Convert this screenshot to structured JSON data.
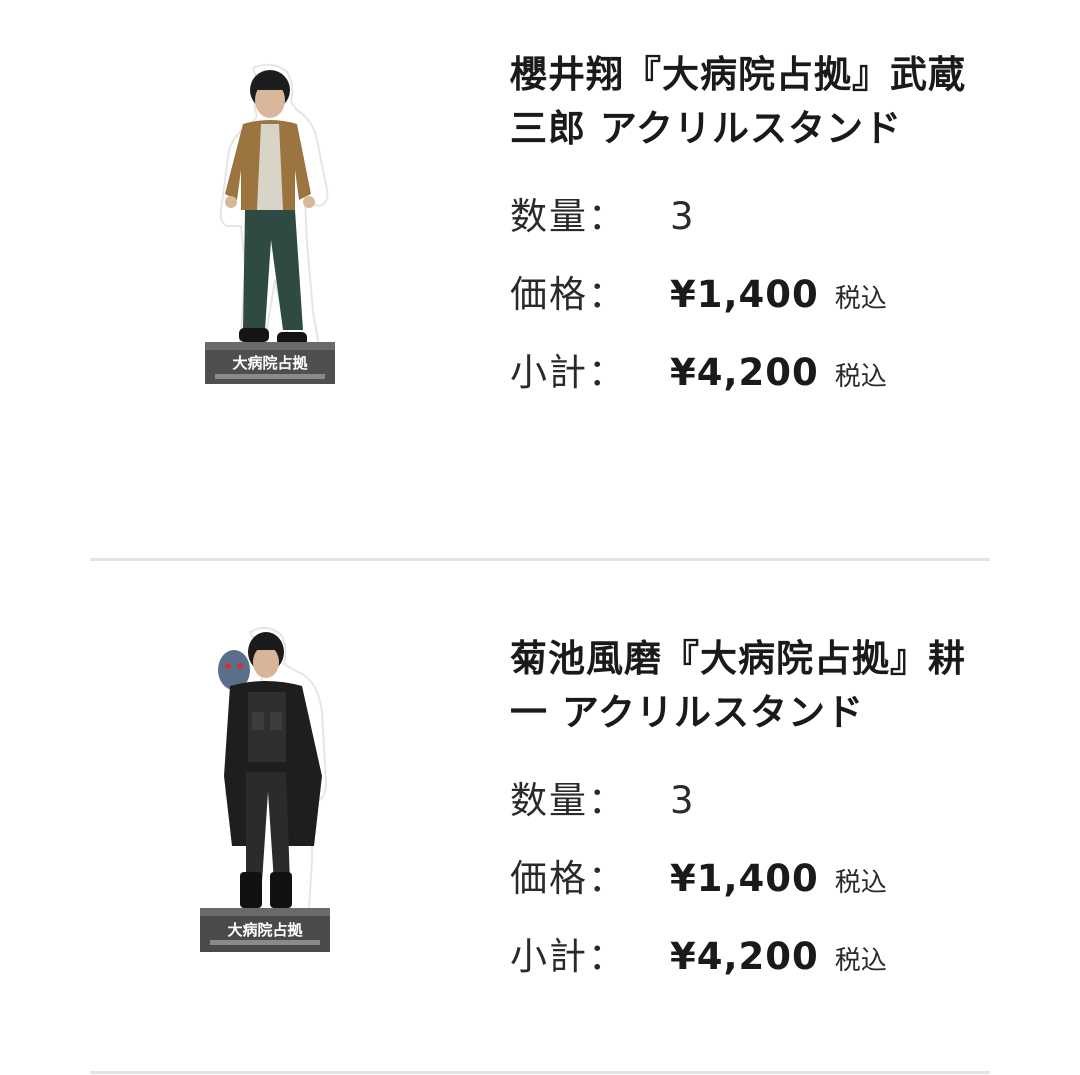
{
  "items": [
    {
      "title": "櫻井翔『大病院占拠』武蔵三郎 アクリルスタンド",
      "qty_label": "数量：",
      "qty": "3",
      "price_label": "価格：",
      "price": "¥1,400",
      "price_tax": "税込",
      "subtotal_label": "小計：",
      "subtotal": "¥4,200",
      "subtotal_tax": "税込",
      "base_text": "大病院占拠"
    },
    {
      "title": "菊池風磨『大病院占拠』耕一 アクリルスタンド",
      "qty_label": "数量：",
      "qty": "3",
      "price_label": "価格：",
      "price": "¥1,400",
      "price_tax": "税込",
      "subtotal_label": "小計：",
      "subtotal": "¥4,200",
      "subtotal_tax": "税込",
      "base_text": "大病院占拠"
    }
  ]
}
